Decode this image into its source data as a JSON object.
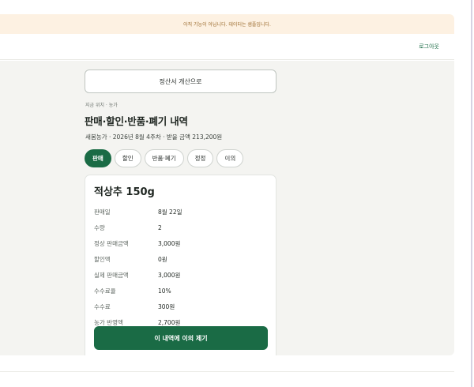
{
  "banner": {
    "text": "아직 기능이 아닙니다. 데이터는 샘플입니다."
  },
  "header": {
    "logout_label": "로그아웃"
  },
  "nav": {
    "back_label": "정산서 개산으로"
  },
  "breadcrumb": "지금 위치 · 농가",
  "page": {
    "title": "판매·할인·반품·폐기 내역",
    "subtitle": "새봄농가 · 2026년 8월 4주차 · 받을 금액 213,200원"
  },
  "tabs": [
    {
      "label": "판매",
      "active": true
    },
    {
      "label": "할인",
      "active": false
    },
    {
      "label": "반품·폐기",
      "active": false
    },
    {
      "label": "정정",
      "active": false
    },
    {
      "label": "이의",
      "active": false
    }
  ],
  "item": {
    "title": "적상추 150g",
    "rows": [
      {
        "key": "판매일",
        "value": "8월 22일"
      },
      {
        "key": "수량",
        "value": "2"
      },
      {
        "key": "정상 판매금액",
        "value": "3,000원"
      },
      {
        "key": "할인액",
        "value": "0원"
      },
      {
        "key": "실제 판매금액",
        "value": "3,000원"
      },
      {
        "key": "수수료율",
        "value": "10%"
      },
      {
        "key": "수수료",
        "value": "300원"
      },
      {
        "key": "농가 반영액",
        "value": "2,700원"
      }
    ],
    "dispute_label": "이 내역에 이의 제기"
  },
  "colors": {
    "accent": "#1a6b45",
    "banner_bg": "#fdf1e2",
    "page_bg": "#f4f4f1"
  }
}
